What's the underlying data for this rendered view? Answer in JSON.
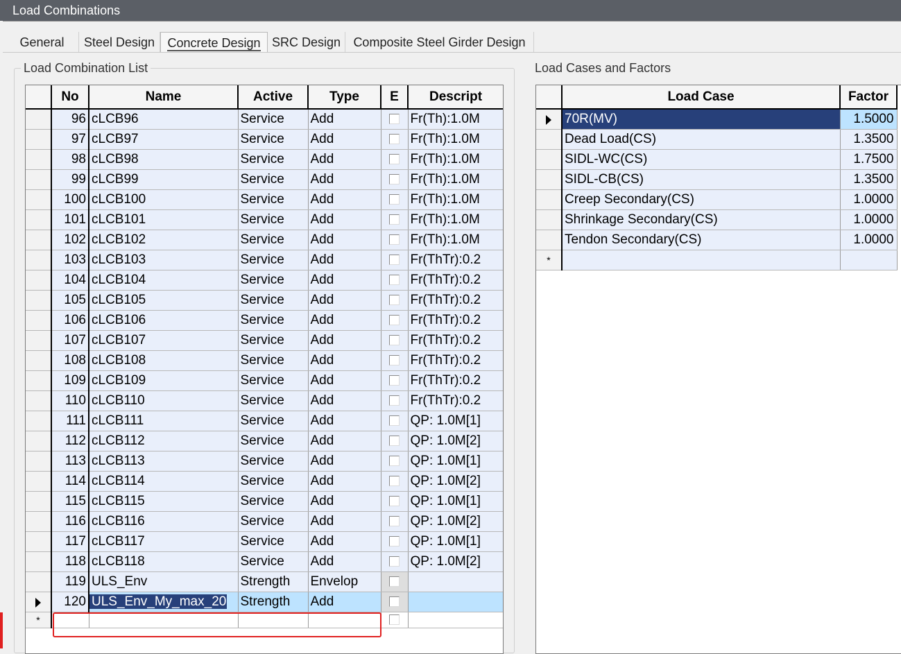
{
  "window": {
    "title": "Load Combinations"
  },
  "tabs": [
    "General",
    "Steel Design",
    "Concrete Design",
    "SRC Design",
    "Composite Steel Girder Design"
  ],
  "active_tab": "Concrete Design",
  "combo_list": {
    "label": "Load Combination List",
    "headers": {
      "no": "No",
      "name": "Name",
      "active": "Active",
      "type": "Type",
      "e": "E",
      "desc": "Descript"
    },
    "rows": [
      {
        "no": "96",
        "name": "cLCB96",
        "active": "Service",
        "type": "Add",
        "desc": "Fr(Th):1.0M"
      },
      {
        "no": "97",
        "name": "cLCB97",
        "active": "Service",
        "type": "Add",
        "desc": "Fr(Th):1.0M"
      },
      {
        "no": "98",
        "name": "cLCB98",
        "active": "Service",
        "type": "Add",
        "desc": "Fr(Th):1.0M"
      },
      {
        "no": "99",
        "name": "cLCB99",
        "active": "Service",
        "type": "Add",
        "desc": "Fr(Th):1.0M"
      },
      {
        "no": "100",
        "name": "cLCB100",
        "active": "Service",
        "type": "Add",
        "desc": "Fr(Th):1.0M"
      },
      {
        "no": "101",
        "name": "cLCB101",
        "active": "Service",
        "type": "Add",
        "desc": "Fr(Th):1.0M"
      },
      {
        "no": "102",
        "name": "cLCB102",
        "active": "Service",
        "type": "Add",
        "desc": "Fr(Th):1.0M"
      },
      {
        "no": "103",
        "name": "cLCB103",
        "active": "Service",
        "type": "Add",
        "desc": "Fr(ThTr):0.2"
      },
      {
        "no": "104",
        "name": "cLCB104",
        "active": "Service",
        "type": "Add",
        "desc": "Fr(ThTr):0.2"
      },
      {
        "no": "105",
        "name": "cLCB105",
        "active": "Service",
        "type": "Add",
        "desc": "Fr(ThTr):0.2"
      },
      {
        "no": "106",
        "name": "cLCB106",
        "active": "Service",
        "type": "Add",
        "desc": "Fr(ThTr):0.2"
      },
      {
        "no": "107",
        "name": "cLCB107",
        "active": "Service",
        "type": "Add",
        "desc": "Fr(ThTr):0.2"
      },
      {
        "no": "108",
        "name": "cLCB108",
        "active": "Service",
        "type": "Add",
        "desc": "Fr(ThTr):0.2"
      },
      {
        "no": "109",
        "name": "cLCB109",
        "active": "Service",
        "type": "Add",
        "desc": "Fr(ThTr):0.2"
      },
      {
        "no": "110",
        "name": "cLCB110",
        "active": "Service",
        "type": "Add",
        "desc": "Fr(ThTr):0.2"
      },
      {
        "no": "111",
        "name": "cLCB111",
        "active": "Service",
        "type": "Add",
        "desc": "QP: 1.0M[1]"
      },
      {
        "no": "112",
        "name": "cLCB112",
        "active": "Service",
        "type": "Add",
        "desc": "QP: 1.0M[2]"
      },
      {
        "no": "113",
        "name": "cLCB113",
        "active": "Service",
        "type": "Add",
        "desc": "QP: 1.0M[1]"
      },
      {
        "no": "114",
        "name": "cLCB114",
        "active": "Service",
        "type": "Add",
        "desc": "QP: 1.0M[2]"
      },
      {
        "no": "115",
        "name": "cLCB115",
        "active": "Service",
        "type": "Add",
        "desc": "QP: 1.0M[1]"
      },
      {
        "no": "116",
        "name": "cLCB116",
        "active": "Service",
        "type": "Add",
        "desc": "QP: 1.0M[2]"
      },
      {
        "no": "117",
        "name": "cLCB117",
        "active": "Service",
        "type": "Add",
        "desc": "QP: 1.0M[1]"
      },
      {
        "no": "118",
        "name": "cLCB118",
        "active": "Service",
        "type": "Add",
        "desc": "QP: 1.0M[2]"
      },
      {
        "no": "119",
        "name": "ULS_Env",
        "active": "Strength",
        "type": "Envelop",
        "desc": ""
      },
      {
        "no": "120",
        "name": "ULS_Env_My_max_20",
        "active": "Strength",
        "type": "Add",
        "desc": ""
      }
    ],
    "new_row_marker": "*"
  },
  "cases": {
    "label": "Load Cases and Factors",
    "headers": {
      "case": "Load Case",
      "factor": "Factor"
    },
    "rows": [
      {
        "case": "70R(MV)",
        "factor": "1.5000"
      },
      {
        "case": "Dead Load(CS)",
        "factor": "1.3500"
      },
      {
        "case": "SIDL-WC(CS)",
        "factor": "1.7500"
      },
      {
        "case": "SIDL-CB(CS)",
        "factor": "1.3500"
      },
      {
        "case": "Creep Secondary(CS)",
        "factor": "1.0000"
      },
      {
        "case": "Shrinkage Secondary(CS)",
        "factor": "1.0000"
      },
      {
        "case": "Tendon Secondary(CS)",
        "factor": "1.0000"
      }
    ],
    "new_row_marker": "*"
  },
  "colors": {
    "selection": "#27407a",
    "highlight": "#bde3ff",
    "cell": "#e9effb",
    "annotation": "#e02020"
  }
}
